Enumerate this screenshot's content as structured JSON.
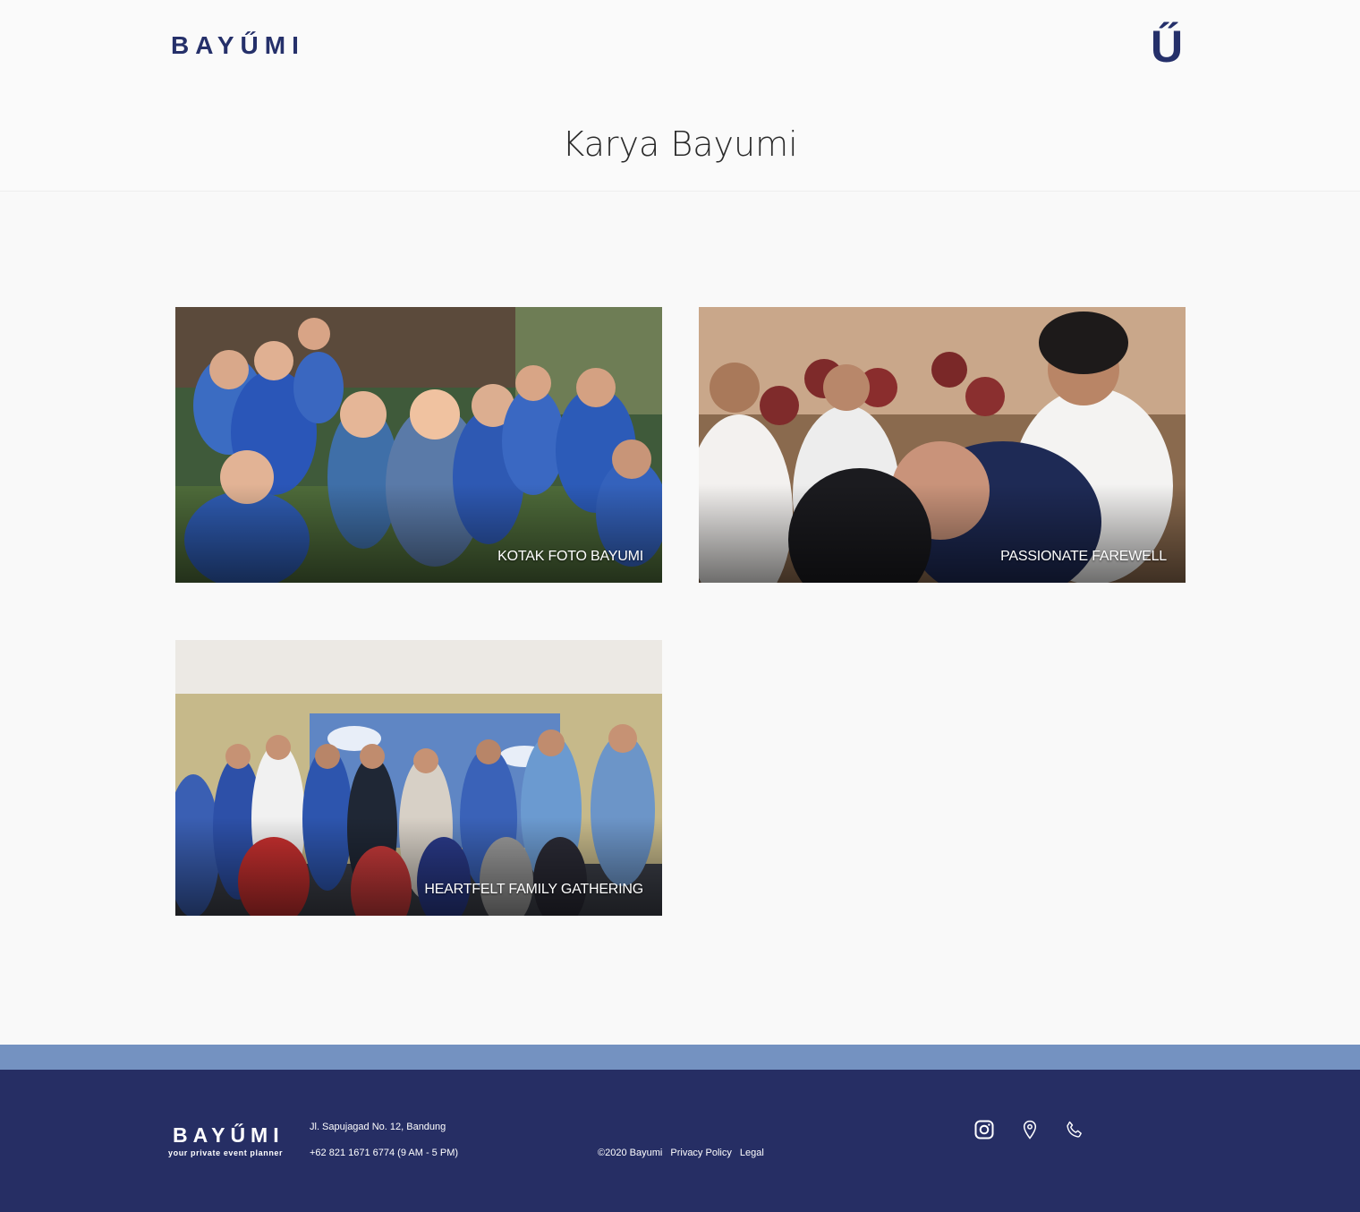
{
  "header": {
    "logo": "BAYŰMI",
    "menu_mark": "Ű",
    "page_title": "Karya Bayumi"
  },
  "gallery": [
    {
      "caption": "KOTAK FOTO BAYUMI"
    },
    {
      "caption": "PASSIONATE FAREWELL"
    },
    {
      "caption": "HEARTFELT FAMILY GATHERING"
    }
  ],
  "footer": {
    "logo": "BAYŰMI",
    "tagline": "your private event planner",
    "address": "Jl. Sapujagad No. 12, Bandung",
    "phone": "+62 821 1671 6774 (9 AM - 5 PM)",
    "copyright": "©2020 Bayumi",
    "privacy": "Privacy Policy",
    "legal": "Legal",
    "icons": [
      "instagram-icon",
      "location-pin-icon",
      "phone-icon"
    ]
  },
  "colors": {
    "brand_navy": "#25306a",
    "footer_bg": "#262e64",
    "footer_band": "#7492c1",
    "page_bg": "#f9f9f9"
  }
}
